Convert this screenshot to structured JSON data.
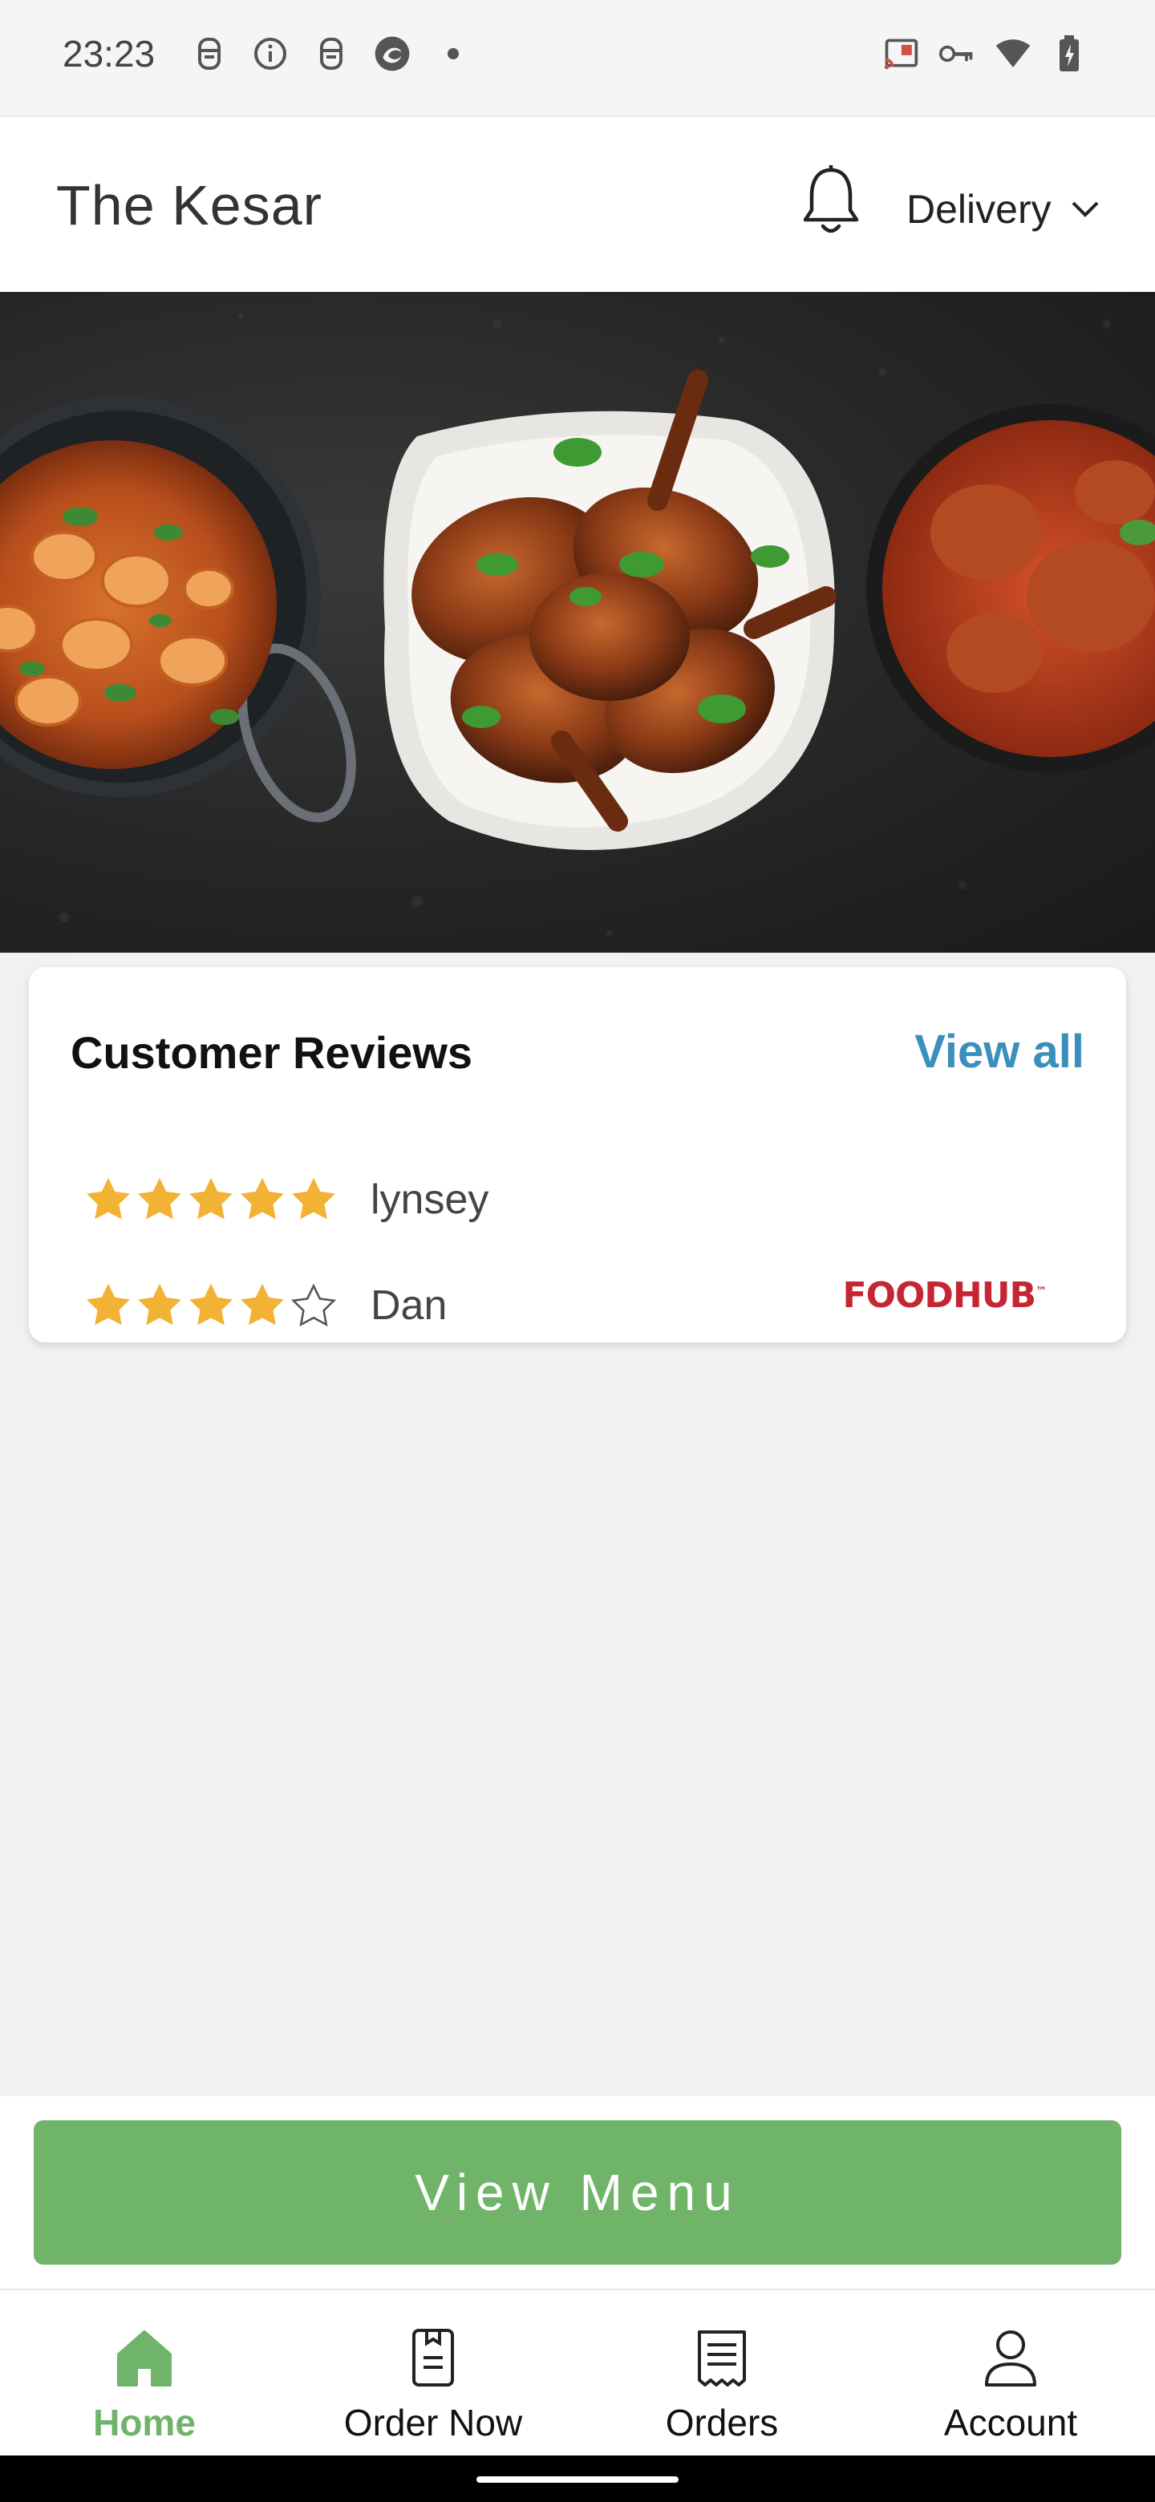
{
  "status_bar": {
    "time": "23:23",
    "left_icons": [
      "assistant-icon",
      "info-icon",
      "assistant-icon",
      "browser-icon",
      "dot-icon"
    ],
    "right_icons": [
      "cast-icon",
      "vpn-key-icon",
      "wifi-icon",
      "battery-charging-icon"
    ]
  },
  "header": {
    "title": "The Kesar",
    "bell_icon": "bell-icon",
    "delivery_label": "Delivery",
    "chevron_icon": "chevron-down-icon"
  },
  "hero": {
    "image": "food-dishes-banner"
  },
  "reviews": {
    "title": "Customer Reviews",
    "view_all": "View all",
    "items": [
      {
        "name": "lynsey",
        "rating": 5,
        "max": 5
      },
      {
        "name": "Dan",
        "rating": 4,
        "max": 5
      }
    ],
    "provider_logo": "FOODHUB"
  },
  "view_menu": {
    "label": "View Menu"
  },
  "bottom_nav": {
    "items": [
      {
        "label": "Home",
        "icon": "home-icon",
        "active": true
      },
      {
        "label": "Order Now",
        "icon": "order-now-icon",
        "active": false
      },
      {
        "label": "Orders",
        "icon": "receipt-icon",
        "active": false
      },
      {
        "label": "Account",
        "icon": "account-icon",
        "active": false
      }
    ]
  },
  "colors": {
    "accent_green": "#70b46a",
    "link_blue": "#3b8fbd",
    "star_gold": "#f2b233",
    "foodhub_red": "#c62633"
  }
}
